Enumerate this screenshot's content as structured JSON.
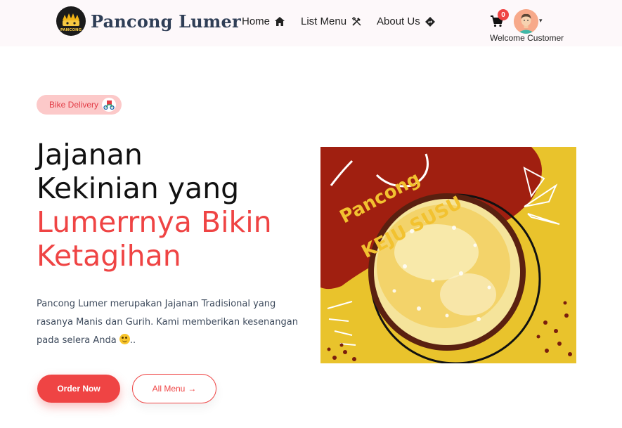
{
  "brand": {
    "name": "Pancong Lumer",
    "logo_text": "PANCONG"
  },
  "nav": {
    "links": [
      {
        "label": "Home",
        "icon": "home-icon"
      },
      {
        "label": "List Menu",
        "icon": "utensils-icon"
      },
      {
        "label": "About Us",
        "icon": "direction-icon"
      }
    ],
    "cart_count": "0",
    "welcome": "Welcome Customer"
  },
  "hero": {
    "badge": "Bike Delivery",
    "headline_dark": [
      "Jajanan",
      "Kekinian yang"
    ],
    "headline_red": [
      "Lumerrnya Bikin",
      "Ketagihan"
    ],
    "description": "Pancong Lumer merupakan Jajanan Tradisional yang rasanya Manis dan Gurih. Kami memberikan kesenangan pada selera Anda",
    "description_suffix": "..",
    "order_button": "Order Now",
    "menu_button": "All Menu",
    "image": {
      "title_line1": "Pancong",
      "title_line2": "KEJU SUSU"
    }
  },
  "colors": {
    "accent": "#ef4444",
    "badge_bg": "#fcc9c9",
    "brand_text": "#2f3e56",
    "image_red": "#a01f10",
    "image_yellow": "#e9c32c"
  }
}
